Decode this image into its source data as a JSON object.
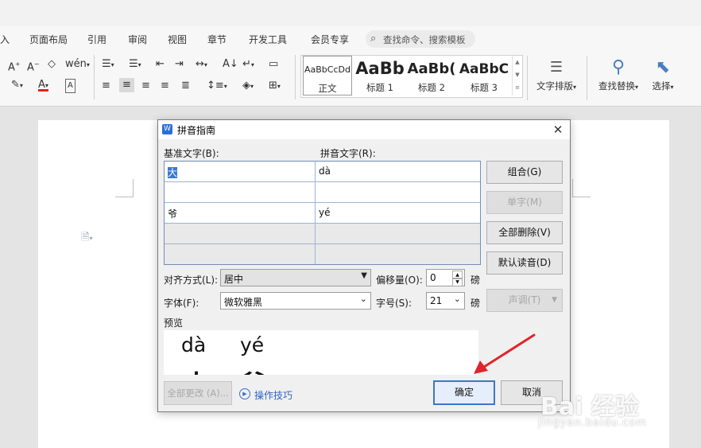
{
  "ribbon": {
    "tabs": [
      "入",
      "页面布局",
      "引用",
      "审阅",
      "视图",
      "章节",
      "开发工具",
      "会员专享"
    ],
    "search_placeholder": "查找命令、搜索模板",
    "styles": [
      {
        "sample": "AaBbCcDd",
        "name": "正文"
      },
      {
        "sample": "AaBb",
        "name": "标题 1"
      },
      {
        "sample": "AaBb(",
        "name": "标题 2"
      },
      {
        "sample": "AaBbC",
        "name": "标题 3"
      }
    ],
    "big_tools": {
      "text_layout": "文字排版",
      "find_replace": "查找替换",
      "select": "选择"
    }
  },
  "dialog": {
    "title": "拼音指南",
    "base_text_label": "基准文字(B):",
    "ruby_text_label": "拼音文字(R):",
    "rows": [
      {
        "base": "大",
        "ruby": "dà",
        "enabled": true
      },
      {
        "base": "",
        "ruby": "",
        "enabled": true
      },
      {
        "base": "爷",
        "ruby": "yé",
        "enabled": true
      },
      {
        "base": "",
        "ruby": "",
        "enabled": false
      },
      {
        "base": "",
        "ruby": "",
        "enabled": false
      }
    ],
    "buttons": {
      "group": "组合(G)",
      "single": "单字(M)",
      "clear_all": "全部删除(V)",
      "default_reading": "默认读音(D)",
      "tone": "声调(T)",
      "change_all": "全部更改 (A)...",
      "ok": "确定",
      "cancel": "取消"
    },
    "align_label": "对齐方式(L):",
    "align_value": "居中",
    "offset_label": "偏移量(O):",
    "offset_value": "0",
    "offset_unit": "磅",
    "font_label": "字体(F):",
    "font_value": "微软雅黑",
    "size_label": "字号(S):",
    "size_value": "21",
    "size_unit": "磅",
    "preview_label": "预览",
    "preview": {
      "pinyin": [
        "dà",
        "yé"
      ],
      "hanzi": [
        "大",
        "爷"
      ]
    },
    "tips_link": "操作技巧"
  },
  "watermark": {
    "brand": "Bai  经验",
    "url": "jingyan.baidu.com"
  },
  "colors": {
    "accent": "#3a78c6",
    "annotation_arrow": "#e0242b"
  }
}
